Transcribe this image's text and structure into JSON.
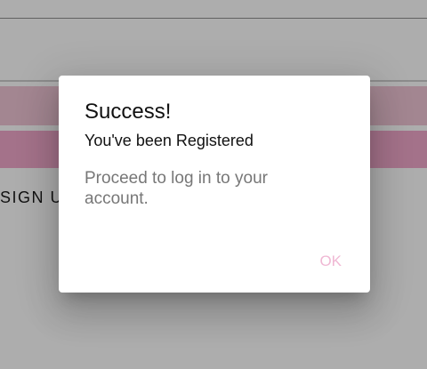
{
  "background": {
    "signup_label": "SIGN UP",
    "colors": {
      "field_bar_light": "#f0c6d6",
      "field_bar_pink": "#f2a8cc"
    }
  },
  "dialog": {
    "title": "Success!",
    "subtitle": "You've been Registered",
    "message": "Proceed to log in to your account.",
    "ok_label": "OK",
    "colors": {
      "ok_text": "#f0b8d4"
    }
  }
}
